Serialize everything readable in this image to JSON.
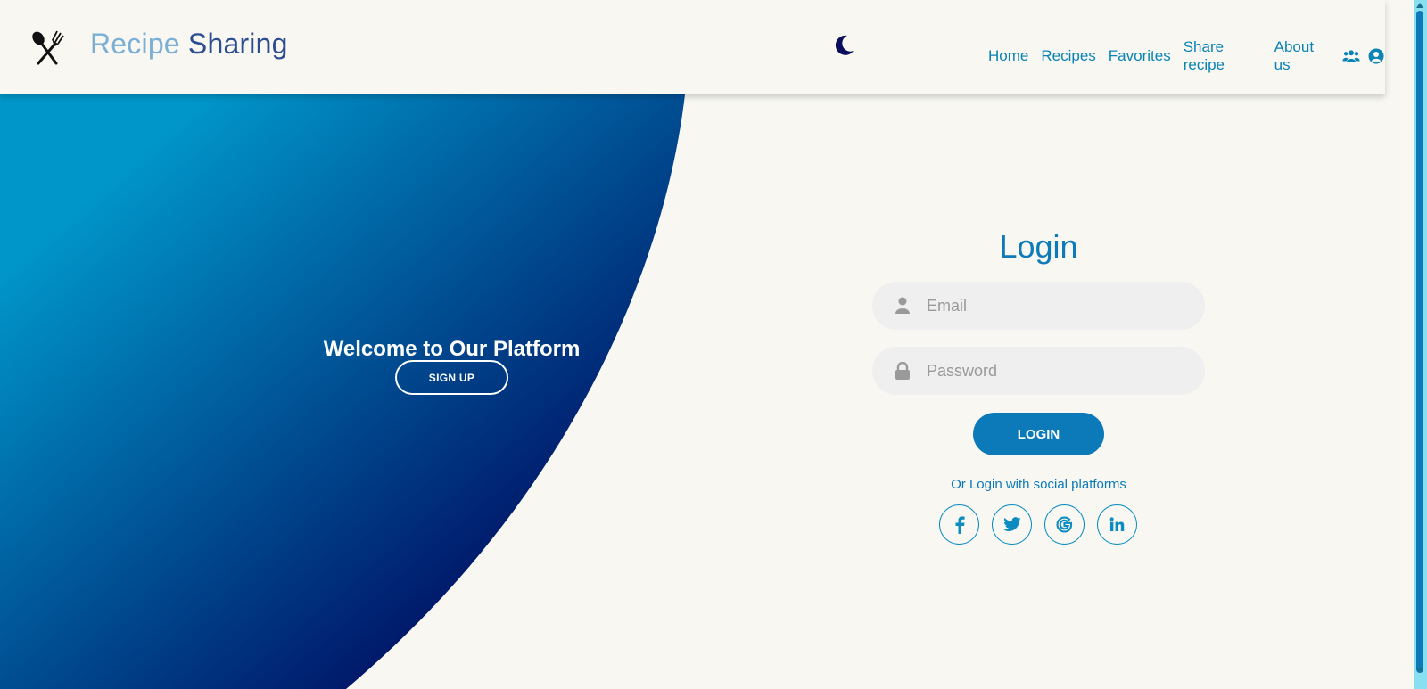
{
  "header": {
    "brand_word1": "Recipe",
    "brand_word2": "Sharing",
    "logo_icon": "fork-and-spoon-icon",
    "theme_toggle_icon": "moon-icon",
    "nav": [
      {
        "label": "Home"
      },
      {
        "label": "Recipes"
      },
      {
        "label": "Favorites"
      },
      {
        "label": "Share recipe"
      },
      {
        "label": "About us"
      }
    ],
    "nav_icons": [
      "users-icon",
      "user-circle-icon"
    ]
  },
  "hero": {
    "title": "Welcome to Our Platform",
    "signup_label": "SIGN UP",
    "colors": {
      "light": "#0096c9",
      "dark": "#001a6b"
    }
  },
  "login": {
    "title": "Login",
    "email_placeholder": "Email",
    "password_placeholder": "Password",
    "login_label": "LOGIN",
    "social_text": "Or Login with social platforms",
    "socials": [
      {
        "name": "facebook",
        "glyph": "f"
      },
      {
        "name": "twitter",
        "glyph": "twitter"
      },
      {
        "name": "google",
        "glyph": "G"
      },
      {
        "name": "linkedin",
        "glyph": "in"
      }
    ]
  },
  "colors": {
    "accent": "#0c79b8",
    "page_bg": "#f8f7f2",
    "field_bg": "#efefef"
  }
}
